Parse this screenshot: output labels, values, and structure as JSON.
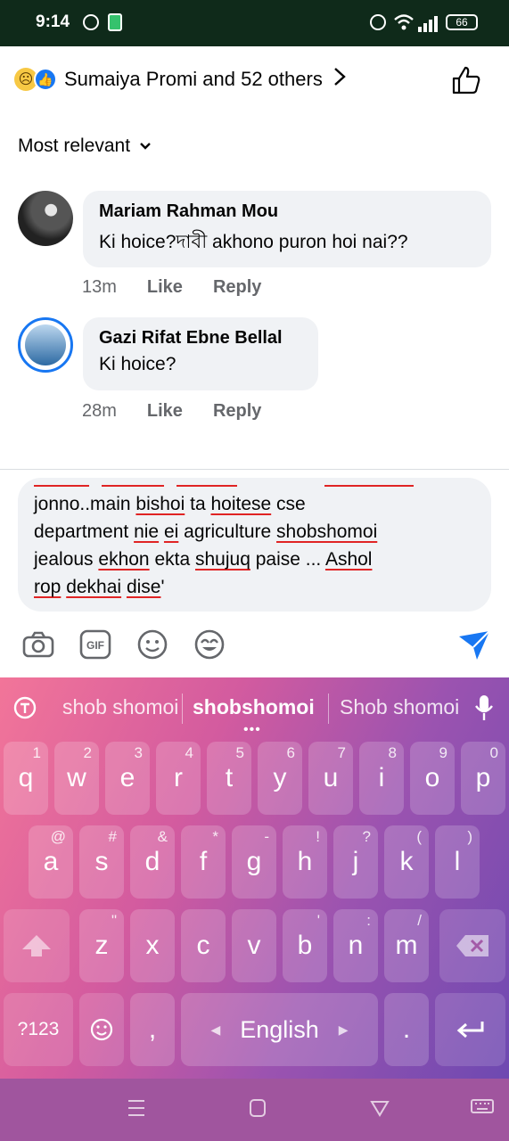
{
  "status_bar": {
    "time": "9:14",
    "battery": "66"
  },
  "reactions": {
    "summary": "Sumaiya Promi and 52 others",
    "icons": [
      "sad-emoji",
      "like-emoji"
    ]
  },
  "sort": {
    "label": "Most relevant"
  },
  "comments": [
    {
      "author": "Mariam Rahman Mou",
      "text": "Ki hoice?দাবী  akhono puron hoi nai??",
      "time": "13m",
      "like_label": "Like",
      "reply_label": "Reply"
    },
    {
      "author": "Gazi Rifat Ebne Bellal",
      "text": "Ki hoice?",
      "time": "28m",
      "like_label": "Like",
      "reply_label": "Reply"
    }
  ],
  "composer": {
    "line1": [
      "jonno..main ",
      "bishoi",
      " ta ",
      "hoitese",
      " cse"
    ],
    "line2": [
      "department ",
      "nie",
      " ",
      "ei",
      " agriculture ",
      "shobshomoi"
    ],
    "line3": [
      "jealous ",
      "ekhon",
      " ekta ",
      "shujuq",
      " paise ... ",
      "Ashol"
    ],
    "line4": [
      "rop",
      " ",
      "dekhai",
      " ",
      "dise",
      "'"
    ]
  },
  "composer_tools": [
    "camera-icon",
    "gif-icon",
    "sticker-icon",
    "avatar-sticker-icon",
    "send-icon"
  ],
  "keyboard": {
    "suggestions": [
      "shob shomoi",
      "shobshomoi",
      "Shob shomoi"
    ],
    "row1": [
      {
        "key": "q",
        "hint": "1"
      },
      {
        "key": "w",
        "hint": "2"
      },
      {
        "key": "e",
        "hint": "3"
      },
      {
        "key": "r",
        "hint": "4"
      },
      {
        "key": "t",
        "hint": "5"
      },
      {
        "key": "y",
        "hint": "6"
      },
      {
        "key": "u",
        "hint": "7"
      },
      {
        "key": "i",
        "hint": "8"
      },
      {
        "key": "o",
        "hint": "9"
      },
      {
        "key": "p",
        "hint": "0"
      }
    ],
    "row2": [
      {
        "key": "a",
        "hint": "@"
      },
      {
        "key": "s",
        "hint": "#"
      },
      {
        "key": "d",
        "hint": "&"
      },
      {
        "key": "f",
        "hint": "*"
      },
      {
        "key": "g",
        "hint": "-"
      },
      {
        "key": "h",
        "hint": "!"
      },
      {
        "key": "j",
        "hint": "?"
      },
      {
        "key": "k",
        "hint": "("
      },
      {
        "key": "l",
        "hint": ")"
      }
    ],
    "row3": [
      {
        "key": "z",
        "hint": "\""
      },
      {
        "key": "x",
        "hint": ""
      },
      {
        "key": "c",
        "hint": ""
      },
      {
        "key": "v",
        "hint": ""
      },
      {
        "key": "b",
        "hint": "'"
      },
      {
        "key": "n",
        "hint": ":"
      },
      {
        "key": "m",
        "hint": "/"
      }
    ],
    "symbols_label": "?123",
    "comma_label": ",",
    "space_label": "English",
    "period_label": "."
  }
}
